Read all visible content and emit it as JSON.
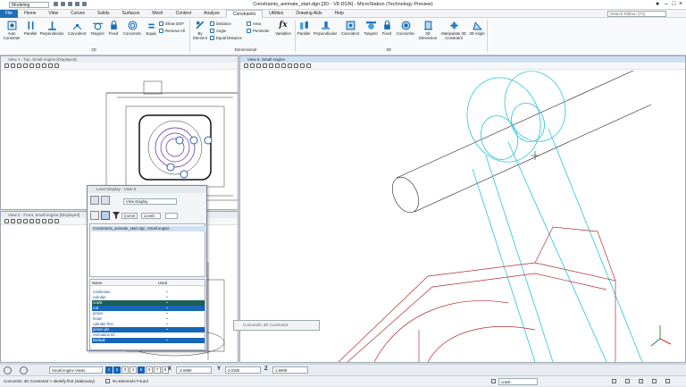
{
  "app": {
    "workspace": "Modeling",
    "title": "Constraints_animate_start.dgn [3D - V8 DGN] - MicroStation (Technology Preview)",
    "search_placeholder": "Search Ribbon (F4)"
  },
  "menu": [
    "File",
    "Home",
    "View",
    "Curves",
    "Solids",
    "Surfaces",
    "Mesh",
    "Content",
    "Analyze",
    "Constraints",
    "Utilities",
    "Drawing Aids",
    "Help"
  ],
  "ribbon": {
    "twod": [
      "Auto Constrain",
      "Parallel",
      "Perpendicular",
      "Coincident",
      "Tangent",
      "Fixed",
      "Concentric",
      "Equal"
    ],
    "twod_small": [
      "Show DOF",
      "Remove All"
    ],
    "group_2d": "2D",
    "dimensional_small": [
      "Distance",
      "Angle",
      "Equal Distance"
    ],
    "by_element": "By Element",
    "measure_small": [
      "Area",
      "Perimeter"
    ],
    "variables": "Variables",
    "fx": "fx",
    "group_dimensional": "Dimensional",
    "threed": [
      "Parallel",
      "Perpendicular",
      "Coincident",
      "Tangent",
      "Fixed",
      "Concentric",
      "3D Dimension",
      "Manipulate 3D Constraint",
      "3D Angle"
    ],
    "group_3d": "3D"
  },
  "views": {
    "v1": "View 1 - Top, Small engine [Displayed]",
    "v2": "View 2 - Front, Small engine [Displayed]",
    "v5": "View 5, Small engine"
  },
  "level_display": {
    "title": "Level Display - View 5",
    "mode": "View Display",
    "filter": "(none)",
    "levels_btn": "Levels",
    "tree_item": "Constraints_animate_start.dgn, Small engine",
    "col_name": "Name",
    "col_used": "Used",
    "levels": [
      {
        "name": "crankcase",
        "used": "•",
        "state": "normal"
      },
      {
        "name": "cylinder",
        "used": "•",
        "state": "normal"
      },
      {
        "name": "crank",
        "used": "•",
        "state": "hl"
      },
      {
        "name": "rod",
        "used": "•",
        "state": "sel"
      },
      {
        "name": "piston",
        "used": "•",
        "state": "normal"
      },
      {
        "name": "head",
        "used": "•",
        "state": "normal"
      },
      {
        "name": "cylinder fins",
        "used": "•",
        "state": "normal"
      },
      {
        "name": "piston pin",
        "used": "•",
        "state": "sel"
      },
      {
        "name": "Animation El...",
        "used": "",
        "state": "normal"
      },
      {
        "name": "Default",
        "used": "•",
        "state": "sel"
      }
    ]
  },
  "concentric_dialog": "Concentric 3D Constraint",
  "viewbar": {
    "view_group": "Small engine Views",
    "views": [
      "1",
      "2",
      "3",
      "4",
      "5",
      "6",
      "7",
      "8"
    ],
    "x_label": "X",
    "x_value": "-2.0690",
    "y_label": "Y",
    "y_value": "2.0150",
    "z_label": "Z",
    "z_value": "1.6005"
  },
  "status": {
    "prompt": "Concentric 3D Constraint > Identify first (stationary)",
    "elements": "No Elements Found",
    "level": "crank"
  },
  "colors": {
    "accent": "#1f6fb8",
    "cyan": "#28c4d8",
    "red": "#b03030"
  }
}
